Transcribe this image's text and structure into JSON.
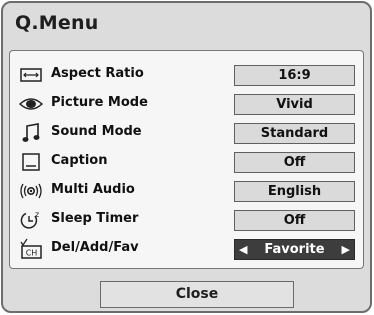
{
  "menu": {
    "title": "Q.Menu",
    "items": [
      {
        "label": "Aspect Ratio",
        "value": "16:9",
        "icon": "aspect-ratio-icon"
      },
      {
        "label": "Picture Mode",
        "value": "Vivid",
        "icon": "eye-icon"
      },
      {
        "label": "Sound Mode",
        "value": "Standard",
        "icon": "music-note-icon"
      },
      {
        "label": "Caption",
        "value": "Off",
        "icon": "caption-icon"
      },
      {
        "label": "Multi Audio",
        "value": "English",
        "icon": "audio-icon"
      },
      {
        "label": "Sleep Timer",
        "value": "Off",
        "icon": "sleep-timer-icon"
      },
      {
        "label": "Del/Add/Fav",
        "value": "Favorite",
        "icon": "channel-icon",
        "selected": true
      }
    ],
    "close_label": "Close",
    "arrow_left": "◀",
    "arrow_right": "▶",
    "channel_icon_text": "CH",
    "sleep_icon_text": "z"
  }
}
